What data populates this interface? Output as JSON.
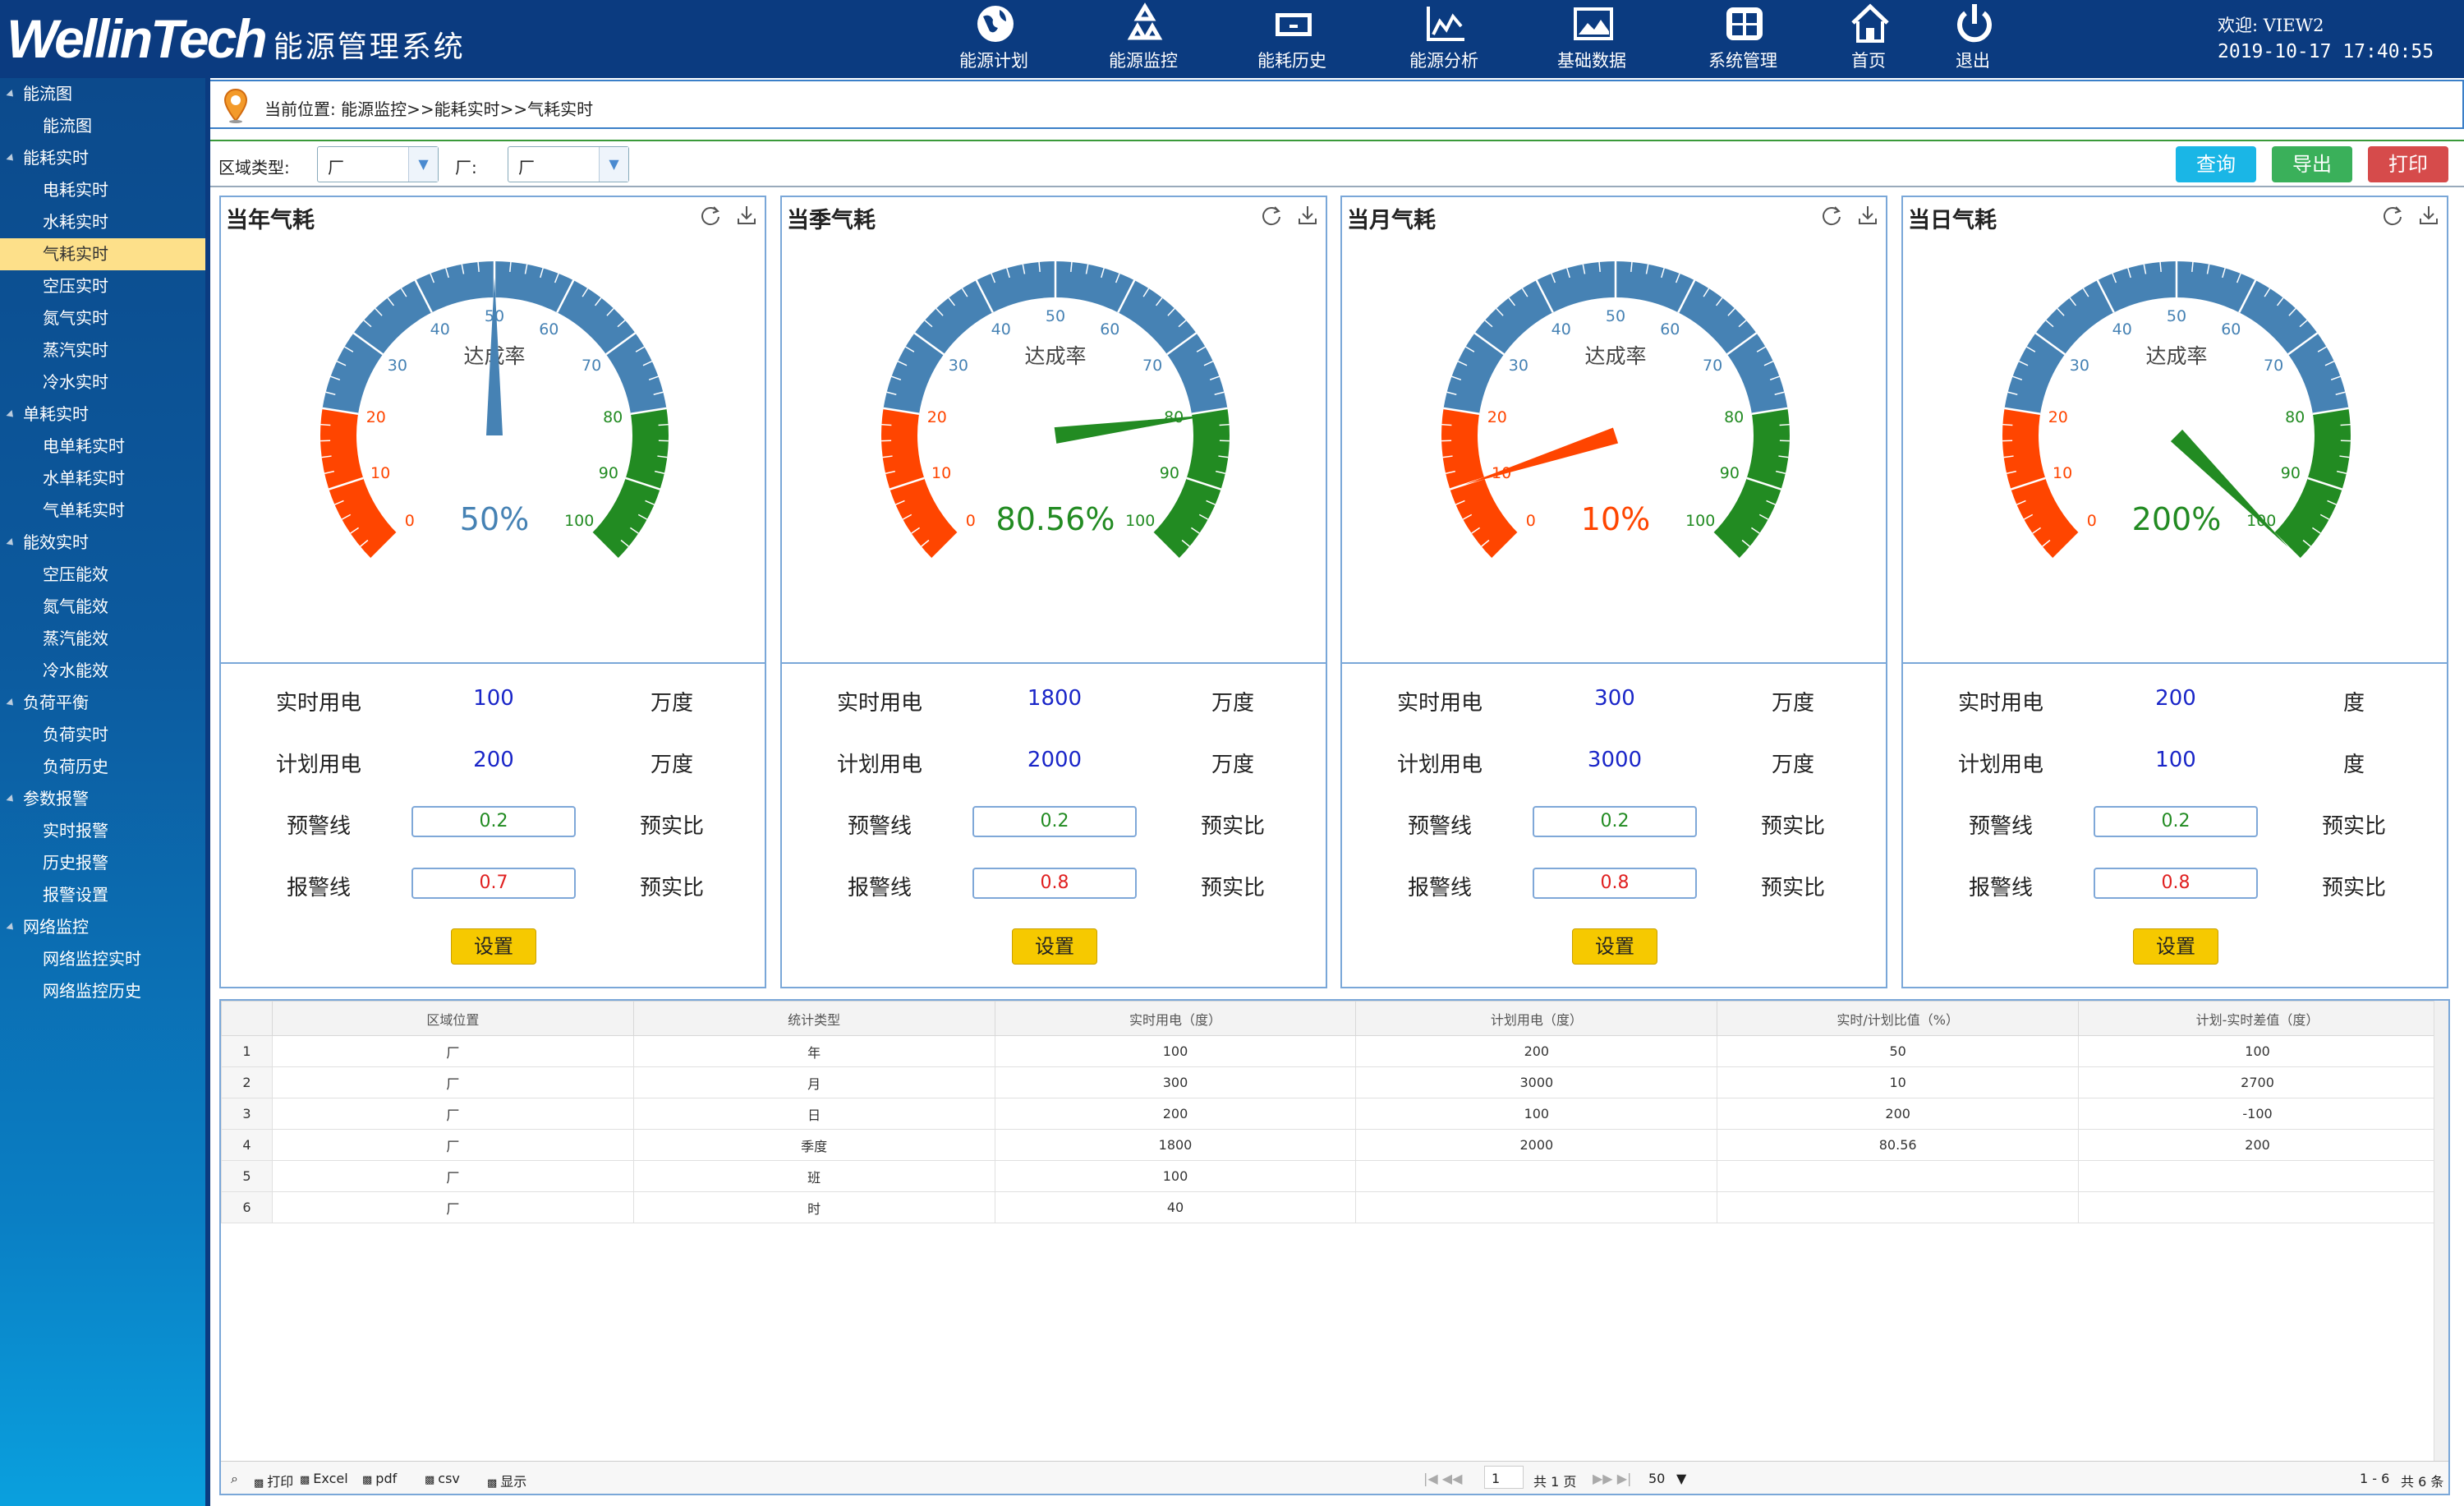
{
  "header": {
    "brand": "WellinTech",
    "system_title": "能源管理系统",
    "nav": [
      {
        "label": "能源计划",
        "icon": "globe-icon"
      },
      {
        "label": "能源监控",
        "icon": "recycle-icon"
      },
      {
        "label": "能耗历史",
        "icon": "monitor-icon"
      },
      {
        "label": "能源分析",
        "icon": "bar-chart-icon"
      },
      {
        "label": "基础数据",
        "icon": "image-icon"
      },
      {
        "label": "系统管理",
        "icon": "windows-icon"
      },
      {
        "label": "首页",
        "icon": "home-icon"
      },
      {
        "label": "退出",
        "icon": "power-icon"
      }
    ],
    "welcome": "欢迎: VIEW2",
    "datetime": "2019-10-17 17:40:55"
  },
  "sidebar": {
    "groups": [
      {
        "label": "能流图",
        "items": [
          "能流图"
        ]
      },
      {
        "label": "能耗实时",
        "items": [
          "电耗实时",
          "水耗实时",
          "气耗实时",
          "空压实时",
          "氮气实时",
          "蒸汽实时",
          "冷水实时"
        ]
      },
      {
        "label": "单耗实时",
        "items": [
          "电单耗实时",
          "水单耗实时",
          "气单耗实时"
        ]
      },
      {
        "label": "能效实时",
        "items": [
          "空压能效",
          "氮气能效",
          "蒸汽能效",
          "冷水能效"
        ]
      },
      {
        "label": "负荷平衡",
        "items": [
          "负荷实时",
          "负荷历史"
        ]
      },
      {
        "label": "参数报警",
        "items": [
          "实时报警",
          "历史报警",
          "报警设置"
        ]
      },
      {
        "label": "网络监控",
        "items": [
          "网络监控实时",
          "网络监控历史"
        ]
      }
    ],
    "active_item": "气耗实时"
  },
  "breadcrumb": {
    "text": "当前位置: 能源监控>>能耗实时>>气耗实时"
  },
  "filter": {
    "area_type_label": "区域类型:",
    "area_type_value": "厂",
    "factory_label": "厂:",
    "factory_value": "厂",
    "query_label": "查询",
    "export_label": "导出",
    "print_label": "打印"
  },
  "colors": {
    "query": "#1ab6e6",
    "export": "#3ab05a",
    "print": "#d64b4b",
    "red": "#ff4500",
    "blue": "#4682b4",
    "green": "#228b22"
  },
  "panels": [
    {
      "title": "当年气耗",
      "gauge": {
        "label": "达成率",
        "value": 50,
        "display": "50%",
        "value_color": "#4682b4"
      },
      "rows": [
        {
          "label": "实时用电",
          "value": "100",
          "unit": "万度"
        },
        {
          "label": "计划用电",
          "value": "200",
          "unit": "万度"
        },
        {
          "label": "预警线",
          "input": "0.2",
          "unit": "预实比",
          "input_color": "#228b22"
        },
        {
          "label": "报警线",
          "input": "0.7",
          "unit": "预实比",
          "input_color": "#e02020"
        }
      ],
      "button": "设置"
    },
    {
      "title": "当季气耗",
      "gauge": {
        "label": "达成率",
        "value": 80.56,
        "display": "80.56%",
        "value_color": "#228b22"
      },
      "rows": [
        {
          "label": "实时用电",
          "value": "1800",
          "unit": "万度"
        },
        {
          "label": "计划用电",
          "value": "2000",
          "unit": "万度"
        },
        {
          "label": "预警线",
          "input": "0.2",
          "unit": "预实比",
          "input_color": "#228b22"
        },
        {
          "label": "报警线",
          "input": "0.8",
          "unit": "预实比",
          "input_color": "#e02020"
        }
      ],
      "button": "设置"
    },
    {
      "title": "当月气耗",
      "gauge": {
        "label": "达成率",
        "value": 10,
        "display": "10%",
        "value_color": "#ff4500"
      },
      "rows": [
        {
          "label": "实时用电",
          "value": "300",
          "unit": "万度"
        },
        {
          "label": "计划用电",
          "value": "3000",
          "unit": "万度"
        },
        {
          "label": "预警线",
          "input": "0.2",
          "unit": "预实比",
          "input_color": "#228b22"
        },
        {
          "label": "报警线",
          "input": "0.8",
          "unit": "预实比",
          "input_color": "#e02020"
        }
      ],
      "button": "设置"
    },
    {
      "title": "当日气耗",
      "gauge": {
        "label": "达成率",
        "value": 200,
        "display": "200%",
        "value_color": "#228b22"
      },
      "rows": [
        {
          "label": "实时用电",
          "value": "200",
          "unit": "度"
        },
        {
          "label": "计划用电",
          "value": "100",
          "unit": "度"
        },
        {
          "label": "预警线",
          "input": "0.2",
          "unit": "预实比",
          "input_color": "#228b22"
        },
        {
          "label": "报警线",
          "input": "0.8",
          "unit": "预实比",
          "input_color": "#e02020"
        }
      ],
      "button": "设置"
    }
  ],
  "gauge_ticks": [
    "0",
    "10",
    "20",
    "30",
    "40",
    "50",
    "60",
    "70",
    "80",
    "90",
    "100"
  ],
  "table": {
    "columns": [
      "",
      "区域位置",
      "统计类型",
      "实时用电（度）",
      "计划用电（度）",
      "实时/计划比值（%）",
      "计划-实时差值（度）"
    ],
    "rows": [
      [
        "1",
        "厂",
        "年",
        "100",
        "200",
        "50",
        "100"
      ],
      [
        "2",
        "厂",
        "月",
        "300",
        "3000",
        "10",
        "2700"
      ],
      [
        "3",
        "厂",
        "日",
        "200",
        "100",
        "200",
        "-100"
      ],
      [
        "4",
        "厂",
        "季度",
        "1800",
        "2000",
        "80.56",
        "200"
      ],
      [
        "5",
        "厂",
        "班",
        "100",
        "",
        "",
        ""
      ],
      [
        "6",
        "厂",
        "时",
        "40",
        "",
        "",
        ""
      ]
    ],
    "footer": {
      "tools": [
        "打印",
        "Excel",
        "pdf",
        "csv",
        "显示"
      ],
      "page_input": "1",
      "page_total": "共 1 页",
      "page_size": "50",
      "range": "1 - 6",
      "total": "共 6 条"
    }
  }
}
